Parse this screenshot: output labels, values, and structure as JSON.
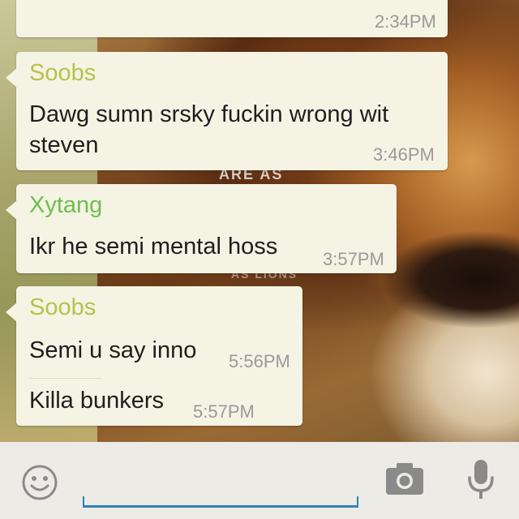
{
  "colors": {
    "bubble_bg": "#f5f3e4",
    "sender_soobs": "#b5c24a",
    "sender_xytang": "#6fbf4d",
    "time_text": "#9a9a9a",
    "input_underline": "#2f84b5",
    "input_bar_bg": "#ecebe6",
    "icon_gray": "#8a8a8a"
  },
  "wallpaper": {
    "text_line1": "ARE AS",
    "text_line2": "AS LIONS"
  },
  "messages": [
    {
      "time": "2:34PM"
    },
    {
      "sender": "Soobs",
      "text_line1": "Dawg sumn srsky fuckin wrong wit",
      "text_line2": "steven",
      "time": "3:46PM"
    },
    {
      "sender": "Xytang",
      "text": "Ikr he semi mental hoss",
      "time": "3:57PM"
    },
    {
      "sender": "Soobs",
      "text": "Semi u say inno",
      "time": "5:56PM",
      "text2": "Killa bunkers",
      "time2": "5:57PM"
    }
  ],
  "input_bar": {
    "placeholder": "",
    "emoji_icon": "smiley-icon",
    "camera_icon": "camera-icon",
    "mic_icon": "microphone-icon"
  }
}
